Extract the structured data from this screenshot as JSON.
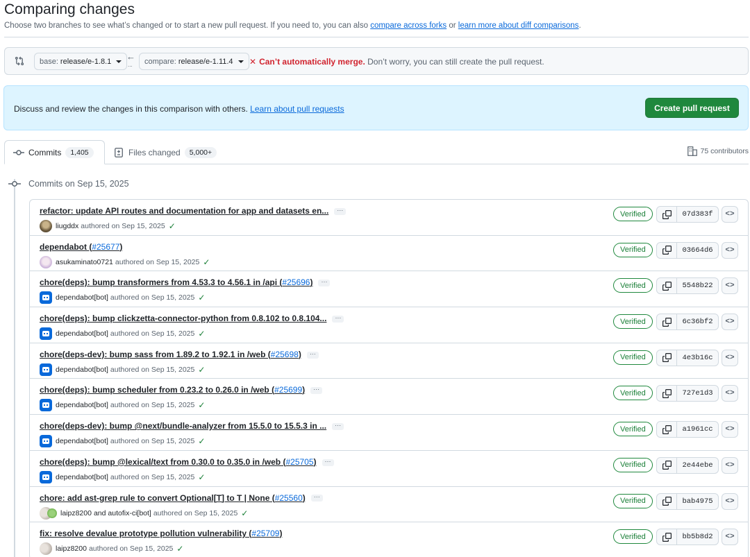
{
  "header": {
    "title": "Comparing changes",
    "subtitle_prefix": "Choose two branches to see what’s changed or to start a new pull request. If you need to, you can also ",
    "link_forks": "compare across forks",
    "subtitle_or": " or ",
    "link_learn": "learn more about diff comparisons",
    "subtitle_end": "."
  },
  "range": {
    "base_label": "base:",
    "base_branch": "release/e-1.8.1",
    "compare_label": "compare:",
    "compare_branch": "release/e-1.11.4",
    "arrow": "←",
    "dots": "...",
    "merge_error": "Can’t automatically merge.",
    "merge_hint": " Don’t worry, you can still create the pull request."
  },
  "flash": {
    "text": "Discuss and review the changes in this comparison with others. ",
    "link": "Learn about pull requests",
    "button": "Create pull request"
  },
  "tabs": {
    "commits_label": "Commits",
    "commits_count": "1,405",
    "files_label": "Files changed",
    "files_count": "5,000+",
    "contributors": "75 contributors"
  },
  "group": {
    "heading": "Commits on Sep 15, 2025"
  },
  "commits": [
    {
      "title": "refactor: update API routes and documentation for app and datasets en...",
      "pr": "",
      "tail": "",
      "ellipsis": true,
      "author": "liugddx",
      "coauthor": "",
      "meta": "authored on Sep 15, 2025",
      "avatar": "photo",
      "verified": "Verified",
      "sha": "07d383f"
    },
    {
      "title": "dependabot (",
      "pr": "#25677",
      "tail": ")",
      "ellipsis": false,
      "author": "asukaminato0721",
      "coauthor": "",
      "meta": "authored on Sep 15, 2025",
      "avatar": "anime",
      "verified": "Verified",
      "sha": "03664d6"
    },
    {
      "title": "chore(deps): bump transformers from 4.53.3 to 4.56.1 in /api (",
      "pr": "#25696",
      "tail": ")",
      "ellipsis": true,
      "author": "dependabot[bot]",
      "coauthor": "",
      "meta": "authored on Sep 15, 2025",
      "avatar": "bot",
      "verified": "Verified",
      "sha": "5548b22"
    },
    {
      "title": "chore(deps): bump clickzetta-connector-python from 0.8.102 to 0.8.104...",
      "pr": "",
      "tail": "",
      "ellipsis": true,
      "author": "dependabot[bot]",
      "coauthor": "",
      "meta": "authored on Sep 15, 2025",
      "avatar": "bot",
      "verified": "Verified",
      "sha": "6c36bf2"
    },
    {
      "title": "chore(deps-dev): bump sass from 1.89.2 to 1.92.1 in /web (",
      "pr": "#25698",
      "tail": ")",
      "ellipsis": true,
      "author": "dependabot[bot]",
      "coauthor": "",
      "meta": "authored on Sep 15, 2025",
      "avatar": "bot",
      "verified": "Verified",
      "sha": "4e3b16c"
    },
    {
      "title": "chore(deps): bump scheduler from 0.23.2 to 0.26.0 in /web (",
      "pr": "#25699",
      "tail": ")",
      "ellipsis": true,
      "author": "dependabot[bot]",
      "coauthor": "",
      "meta": "authored on Sep 15, 2025",
      "avatar": "bot",
      "verified": "Verified",
      "sha": "727e1d3"
    },
    {
      "title": "chore(deps-dev): bump @next/bundle-analyzer from 15.5.0 to 15.5.3 in ...",
      "pr": "",
      "tail": "",
      "ellipsis": true,
      "author": "dependabot[bot]",
      "coauthor": "",
      "meta": "authored on Sep 15, 2025",
      "avatar": "bot",
      "verified": "Verified",
      "sha": "a1961cc"
    },
    {
      "title": "chore(deps): bump @lexical/text from 0.30.0 to 0.35.0 in /web (",
      "pr": "#25705",
      "tail": ")",
      "ellipsis": true,
      "author": "dependabot[bot]",
      "coauthor": "",
      "meta": "authored on Sep 15, 2025",
      "avatar": "bot",
      "verified": "Verified",
      "sha": "2e44ebe"
    },
    {
      "title": "chore: add ast-grep rule to convert Optional[T] to T | None (",
      "pr": "#25560",
      "tail": ")",
      "ellipsis": true,
      "author": "laipz8200",
      "coauthor": "and autofix-ci[bot]",
      "meta": "authored on Sep 15, 2025",
      "avatar": "pair",
      "verified": "Verified",
      "sha": "bab4975"
    },
    {
      "title": "fix: resolve devalue prototype pollution vulnerability (",
      "pr": "#25709",
      "tail": ")",
      "ellipsis": false,
      "author": "laipz8200",
      "coauthor": "",
      "meta": "authored on Sep 15, 2025",
      "avatar": "pair",
      "verified": "Verified",
      "sha": "bb5b8d2"
    }
  ],
  "icons": {
    "compare": "git-compare-icon",
    "commit": "git-commit-icon",
    "files": "file-diff-icon",
    "org": "organization-icon",
    "copy": "copy-icon",
    "browse": "code-icon",
    "check": "check-icon",
    "error": "x-icon"
  },
  "colors": {
    "accent": "#0969da",
    "success": "#1f883d",
    "danger": "#d1242f",
    "flash_bg": "#ddf4ff"
  }
}
